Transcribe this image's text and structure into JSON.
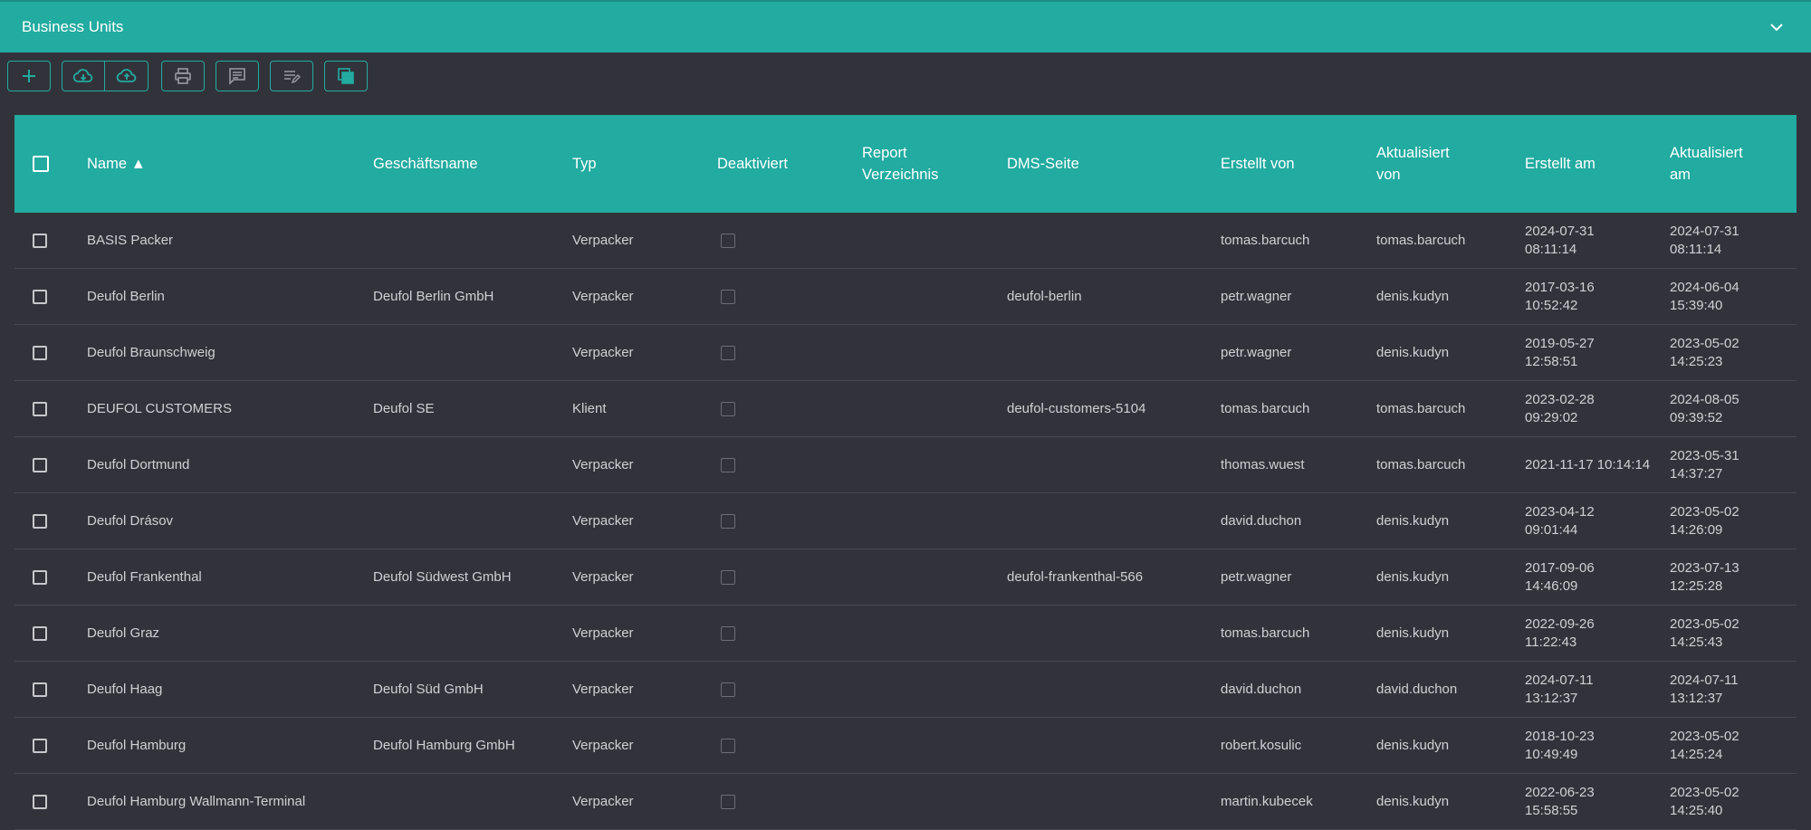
{
  "panel": {
    "title": "Business Units"
  },
  "toolbar": {
    "buttons": [
      {
        "icon": "plus-icon",
        "name": "add-button"
      },
      {
        "icon": "cloud-download-icon",
        "name": "import-button"
      },
      {
        "icon": "cloud-upload-icon",
        "name": "export-button"
      },
      {
        "icon": "print-icon",
        "name": "print-button"
      },
      {
        "icon": "comment-icon",
        "name": "comment-button"
      },
      {
        "icon": "edit-list-icon",
        "name": "bulk-edit-button"
      },
      {
        "icon": "copy-icon",
        "name": "copy-button"
      }
    ]
  },
  "table": {
    "columns": {
      "name": "Name ▲",
      "business_name": "Geschäftsname",
      "type": "Typ",
      "deactivated": "Deaktiviert",
      "report_dir": "Report\nVerzeichnis",
      "dms": "DMS-Seite",
      "created_by": "Erstellt von",
      "updated_by": "Aktualisiert\nvon",
      "created_at": "Erstellt am",
      "updated_at": "Aktualisiert\nam"
    },
    "rows": [
      {
        "name": "BASIS Packer",
        "business_name": "",
        "type": "Verpacker",
        "dms": "",
        "created_by": "tomas.barcuch",
        "updated_by": "tomas.barcuch",
        "created_at": "2024-07-31\n08:11:14",
        "updated_at": "2024-07-31\n08:11:14"
      },
      {
        "name": "Deufol Berlin",
        "business_name": "Deufol Berlin GmbH",
        "type": "Verpacker",
        "dms": "deufol-berlin",
        "created_by": "petr.wagner",
        "updated_by": "denis.kudyn",
        "created_at": "2017-03-16\n10:52:42",
        "updated_at": "2024-06-04\n15:39:40"
      },
      {
        "name": "Deufol Braunschweig",
        "business_name": "",
        "type": "Verpacker",
        "dms": "",
        "created_by": "petr.wagner",
        "updated_by": "denis.kudyn",
        "created_at": "2019-05-27\n12:58:51",
        "updated_at": "2023-05-02\n14:25:23"
      },
      {
        "name": "DEUFOL CUSTOMERS",
        "business_name": "Deufol SE",
        "type": "Klient",
        "dms": "deufol-customers-5104",
        "created_by": "tomas.barcuch",
        "updated_by": "tomas.barcuch",
        "created_at": "2023-02-28\n09:29:02",
        "updated_at": "2024-08-05\n09:39:52"
      },
      {
        "name": "Deufol Dortmund",
        "business_name": "",
        "type": "Verpacker",
        "dms": "",
        "created_by": "thomas.wuest",
        "updated_by": "tomas.barcuch",
        "created_at": "2021-11-17 10:14:14",
        "updated_at": "2023-05-31\n14:37:27"
      },
      {
        "name": "Deufol Drásov",
        "business_name": "",
        "type": "Verpacker",
        "dms": "",
        "created_by": "david.duchon",
        "updated_by": "denis.kudyn",
        "created_at": "2023-04-12\n09:01:44",
        "updated_at": "2023-05-02\n14:26:09"
      },
      {
        "name": "Deufol Frankenthal",
        "business_name": "Deufol Südwest GmbH",
        "type": "Verpacker",
        "dms": "deufol-frankenthal-566",
        "created_by": "petr.wagner",
        "updated_by": "denis.kudyn",
        "created_at": "2017-09-06\n14:46:09",
        "updated_at": "2023-07-13\n12:25:28"
      },
      {
        "name": "Deufol Graz",
        "business_name": "",
        "type": "Verpacker",
        "dms": "",
        "created_by": "tomas.barcuch",
        "updated_by": "denis.kudyn",
        "created_at": "2022-09-26\n11:22:43",
        "updated_at": "2023-05-02\n14:25:43"
      },
      {
        "name": "Deufol Haag",
        "business_name": "Deufol Süd GmbH",
        "type": "Verpacker",
        "dms": "",
        "created_by": "david.duchon",
        "updated_by": "david.duchon",
        "created_at": "2024-07-11\n13:12:37",
        "updated_at": "2024-07-11\n13:12:37"
      },
      {
        "name": "Deufol Hamburg",
        "business_name": "Deufol Hamburg GmbH",
        "type": "Verpacker",
        "dms": "",
        "created_by": "robert.kosulic",
        "updated_by": "denis.kudyn",
        "created_at": "2018-10-23\n10:49:49",
        "updated_at": "2023-05-02\n14:25:24"
      },
      {
        "name": "Deufol Hamburg Wallmann-Terminal",
        "business_name": "",
        "type": "Verpacker",
        "dms": "",
        "created_by": "martin.kubecek",
        "updated_by": "denis.kudyn",
        "created_at": "2022-06-23\n15:58:55",
        "updated_at": "2023-05-02\n14:25:40"
      }
    ]
  }
}
